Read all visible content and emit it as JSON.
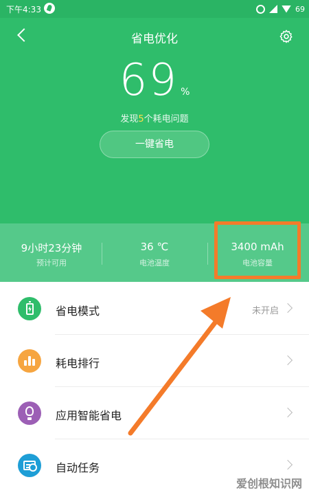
{
  "status_bar": {
    "time": "下午4:33",
    "battery": "69"
  },
  "header": {
    "title": "省电优化",
    "battery_percent": "69",
    "battery_unit": "%",
    "issues_prefix": "发现",
    "issues_count": "5",
    "issues_suffix": "个耗电问题",
    "one_key_button": "一键省电"
  },
  "stats": [
    {
      "value": "9小时23分钟",
      "label": "预计可用"
    },
    {
      "value": "36 ℃",
      "label": "电池温度"
    },
    {
      "value": "3400 mAh",
      "label": "电池容量"
    }
  ],
  "list": [
    {
      "label": "省电模式",
      "status": "未开启",
      "icon": "battery-saver-icon",
      "color": "#2fbd6b"
    },
    {
      "label": "耗电排行",
      "status": "",
      "icon": "bar-chart-icon",
      "color": "#f6a540"
    },
    {
      "label": "应用智能省电",
      "status": "",
      "icon": "lightbulb-icon",
      "color": "#9c5fb5"
    },
    {
      "label": "自动任务",
      "status": "",
      "icon": "scheduled-task-icon",
      "color": "#1e9ed6"
    }
  ],
  "colors": {
    "header_green": "#2fbd6b",
    "stats_green": "#55c98a",
    "highlight_orange": "#f47b2a"
  },
  "watermark": "爱创根知识网"
}
